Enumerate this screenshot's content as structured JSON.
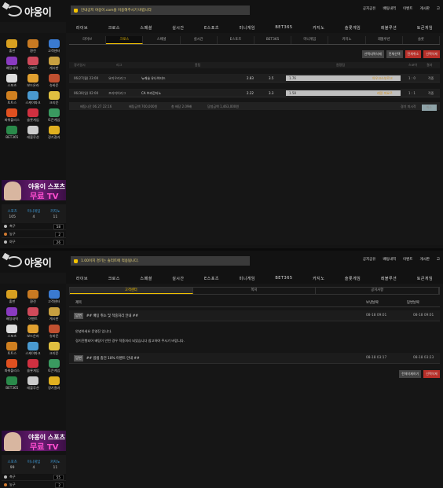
{
  "screen1": {
    "logo": "야옹이",
    "notice": "안내공지 야옹이.com을 이용해주시기 바랍니다",
    "toplinks": [
      "공지공유",
      "배팅내역",
      "이벤트",
      "게시판",
      "고"
    ],
    "nav": [
      "라이브",
      "크로스",
      "스페셜",
      "실시간",
      "E스포츠",
      "미니게임",
      "BET365",
      "카지노",
      "슬롯게임",
      "레볼루션",
      "토큰게임"
    ],
    "tabs": [
      "라이브",
      "크로스",
      "스페셜",
      "실시간",
      "E스포츠",
      "BET365",
      "미니게임",
      "카지노",
      "레볼루션",
      "슬롯"
    ],
    "active_tab": "크로스",
    "buttons": [
      "선택내역삭제",
      "전체선택",
      "전체취소",
      "선택삭제"
    ],
    "headers": [
      "경기일시",
      "리그",
      "홈팀",
      "원정팀",
      "스코어",
      "결과"
    ],
    "rows": [
      {
        "date": "06/27(월) 23:00",
        "league": "요미우리리그",
        "home": "뉴캐슬 유나이티드",
        "odds_home": "2.83",
        "mid": "3.5",
        "pick": "1.76",
        "away": "아우크스부르크",
        "score": "1 : 0",
        "result": "적중"
      },
      {
        "date": "06/30(일) 02:00",
        "league": "프리미어리그",
        "home": "CA 브라간티노",
        "odds_home": "2.22",
        "mid": "3.3",
        "pick": "1.58",
        "away": "레알 마요르",
        "score": "1 : 1",
        "result": "적중"
      }
    ],
    "footer": {
      "time": "배팅시간 06.27 22:16",
      "amount": "배팅금액 700,000원",
      "odds": "총 배당 2.09배",
      "win": "당첨금액 1,463,000원",
      "status": "경기 미시작",
      "cancel": "취소"
    }
  },
  "screen2": {
    "logo": "야옹이",
    "notice": "1.00이지 경기는 솔리트에 적용됩니다.",
    "toplinks": [
      "공지공유",
      "배팅내역",
      "이벤트",
      "게시판",
      "고"
    ],
    "nav": [
      "라이브",
      "크로스",
      "스페셜",
      "실시간",
      "E스포츠",
      "미니게임",
      "BET365",
      "카지노",
      "슬롯게임",
      "레볼루션",
      "토큰게임"
    ],
    "subtabs": [
      "고객센터",
      "쪽지",
      "공지사항"
    ],
    "active_subtab": "고객센터",
    "headers": {
      "title": "제목",
      "date1": "보낸날짜",
      "date2": "답변날짜"
    },
    "items": [
      {
        "tag": "답변",
        "title": "## 배팅 취소 및 적중처리 안내 ##",
        "d1": "08-18 09:01",
        "d2": "08-18 09:01"
      },
      {
        "tag": "답변",
        "title": "## 밤샘 충전 10% 이벤트 안내 ##",
        "d1": "08-18 03:17",
        "d2": "08-18 03:23"
      }
    ],
    "body": [
      "안녕하세요 운영진 입니다.",
      "경기진행되어 배팅이 안된 경우 적중처리 되었습니다 참고하여 주시기 바랍니다."
    ],
    "buttons": [
      "전체삭제하기",
      "선택삭제"
    ]
  },
  "sidebar": {
    "grid": [
      {
        "label": "출판",
        "icon": "coin-icon",
        "color": "#d8a020"
      },
      {
        "label": "환전",
        "icon": "money-icon",
        "color": "#c87a22"
      },
      {
        "label": "고객센터",
        "icon": "chat-icon",
        "color": "#3a7ad0"
      },
      {
        "label": "배팅내역",
        "icon": "list-icon",
        "color": "#8a3ac0"
      },
      {
        "label": "이벤트",
        "icon": "gift-icon",
        "color": "#d04a5a"
      },
      {
        "label": "게시판",
        "icon": "board-icon",
        "color": "#c8a040"
      },
      {
        "label": "스포츠",
        "icon": "ball-icon",
        "color": "#dddddd"
      },
      {
        "label": "보드온라",
        "icon": "crown-icon",
        "color": "#e0a030"
      },
      {
        "label": "슈바운",
        "icon": "stick-icon",
        "color": "#c05030"
      },
      {
        "label": "토트스",
        "icon": "lotto-icon",
        "color": "#d08020"
      },
      {
        "label": "스캐이파크",
        "icon": "dice-icon",
        "color": "#4a9ad0"
      },
      {
        "label": "크리운",
        "icon": "crown2-icon",
        "color": "#e0c040"
      },
      {
        "label": "파워볼리스",
        "icon": "power-icon",
        "color": "#e05020"
      },
      {
        "label": "슬롯게임",
        "icon": "cherry-icon",
        "color": "#d03040"
      },
      {
        "label": "토큰게임",
        "icon": "token-icon",
        "color": "#3a9a60"
      },
      {
        "label": "BET365",
        "icon": "bet-icon",
        "color": "#2a8a4a"
      },
      {
        "label": "레볼루션",
        "icon": "cards-icon",
        "color": "#ccc"
      },
      {
        "label": "경기결과",
        "icon": "chart-icon",
        "color": "#e0b020"
      }
    ],
    "banner": {
      "t1": "야옹이 스포츠",
      "t2": "무료 TV"
    },
    "stats1": [
      {
        "l": "스포츠",
        "v": "105"
      },
      {
        "l": "미니게임",
        "v": "4"
      },
      {
        "l": "카지노",
        "v": "11"
      }
    ],
    "stats2": [
      {
        "l": "스포츠",
        "v": "99"
      },
      {
        "l": "미니게임",
        "v": "4"
      },
      {
        "l": "카지노",
        "v": "11"
      }
    ],
    "sports1": [
      {
        "n": "축구",
        "c": "58"
      },
      {
        "n": "농구",
        "c": "2"
      },
      {
        "n": "야구",
        "c": "26"
      }
    ],
    "sports2": [
      {
        "n": "축구",
        "c": "55"
      },
      {
        "n": "농구",
        "c": "2"
      }
    ]
  }
}
